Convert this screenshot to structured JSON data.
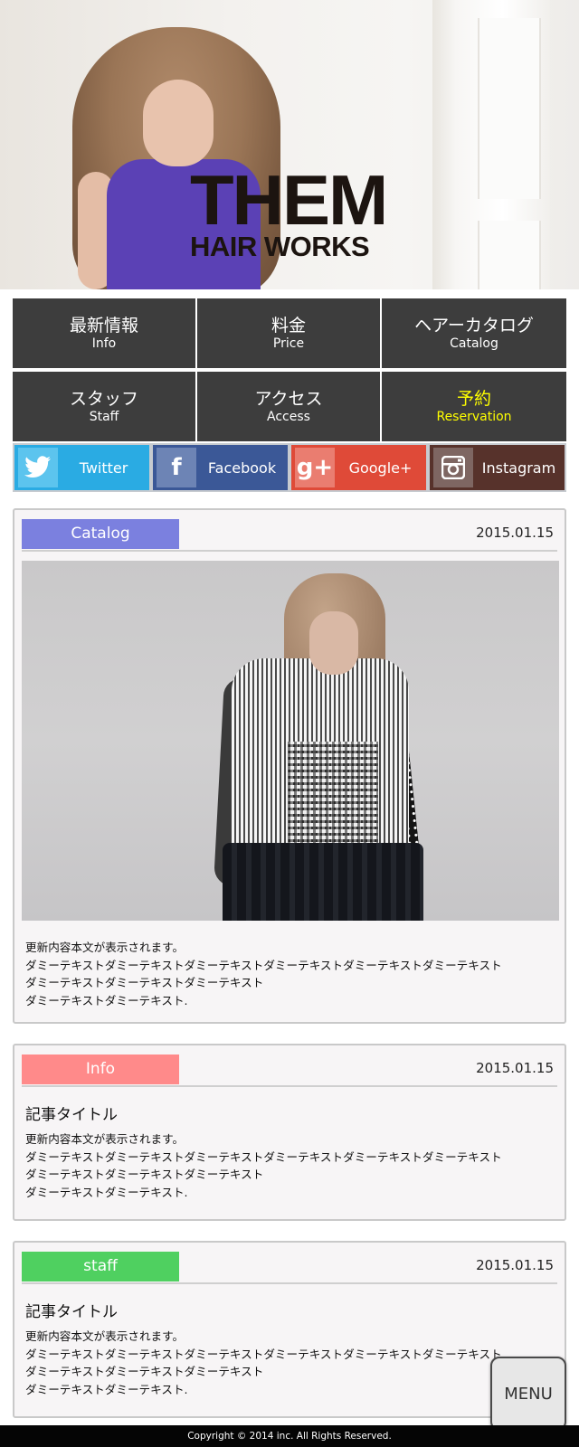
{
  "hero": {
    "logo_line1": "THEM",
    "logo_line2": "HAIR WORKS"
  },
  "nav": {
    "items": [
      {
        "jp": "最新情報",
        "en": "Info"
      },
      {
        "jp": "料金",
        "en": "Price"
      },
      {
        "jp": "ヘアーカタログ",
        "en": "Catalog"
      },
      {
        "jp": "スタッフ",
        "en": "Staff"
      },
      {
        "jp": "アクセス",
        "en": "Access"
      },
      {
        "jp": "予約",
        "en": "Reservation"
      }
    ],
    "accent_color": "#ffff00",
    "background_color": "#3d3d3d"
  },
  "social": {
    "twitter": {
      "label": "Twitter",
      "icon": "twitter-bird-icon",
      "glyph": "🐦",
      "color": "#2aabe3"
    },
    "facebook": {
      "label": "Facebook",
      "icon": "facebook-f-icon",
      "glyph": "f",
      "color": "#3b5897"
    },
    "google": {
      "label": "Google+",
      "icon": "google-plus-icon",
      "glyph": "g+",
      "color": "#df4a38"
    },
    "instagram": {
      "label": "Instagram",
      "icon": "instagram-camera-icon",
      "glyph": "◙",
      "color": "#57322b"
    }
  },
  "posts": [
    {
      "tag": "Catalog",
      "tag_color": "#7b80df",
      "date": "2015.01.15",
      "body": "更新内容本文が表示されます。\nダミーテキストダミーテキストダミーテキストダミーテキストダミーテキストダミーテキスト\nダミーテキストダミーテキストダミーテキスト\nダミーテキストダミーテキスト."
    },
    {
      "tag": "Info",
      "tag_color": "#ff8a8a",
      "date": "2015.01.15",
      "title": "記事タイトル",
      "body": "更新内容本文が表示されます。\nダミーテキストダミーテキストダミーテキストダミーテキストダミーテキストダミーテキスト\nダミーテキストダミーテキストダミーテキスト\nダミーテキストダミーテキスト."
    },
    {
      "tag": "staff",
      "tag_color": "#4fd060",
      "date": "2015.01.15",
      "title": "記事タイトル",
      "body": "更新内容本文が表示されます。\nダミーテキストダミーテキストダミーテキストダミーテキストダミーテキストダミーテキスト\nダミーテキストダミーテキストダミーテキスト\nダミーテキストダミーテキスト."
    }
  ],
  "menu_button": {
    "label": "MENU"
  },
  "footer": {
    "copyright": "Copyright © 2014  inc. All Rights Reserved."
  }
}
